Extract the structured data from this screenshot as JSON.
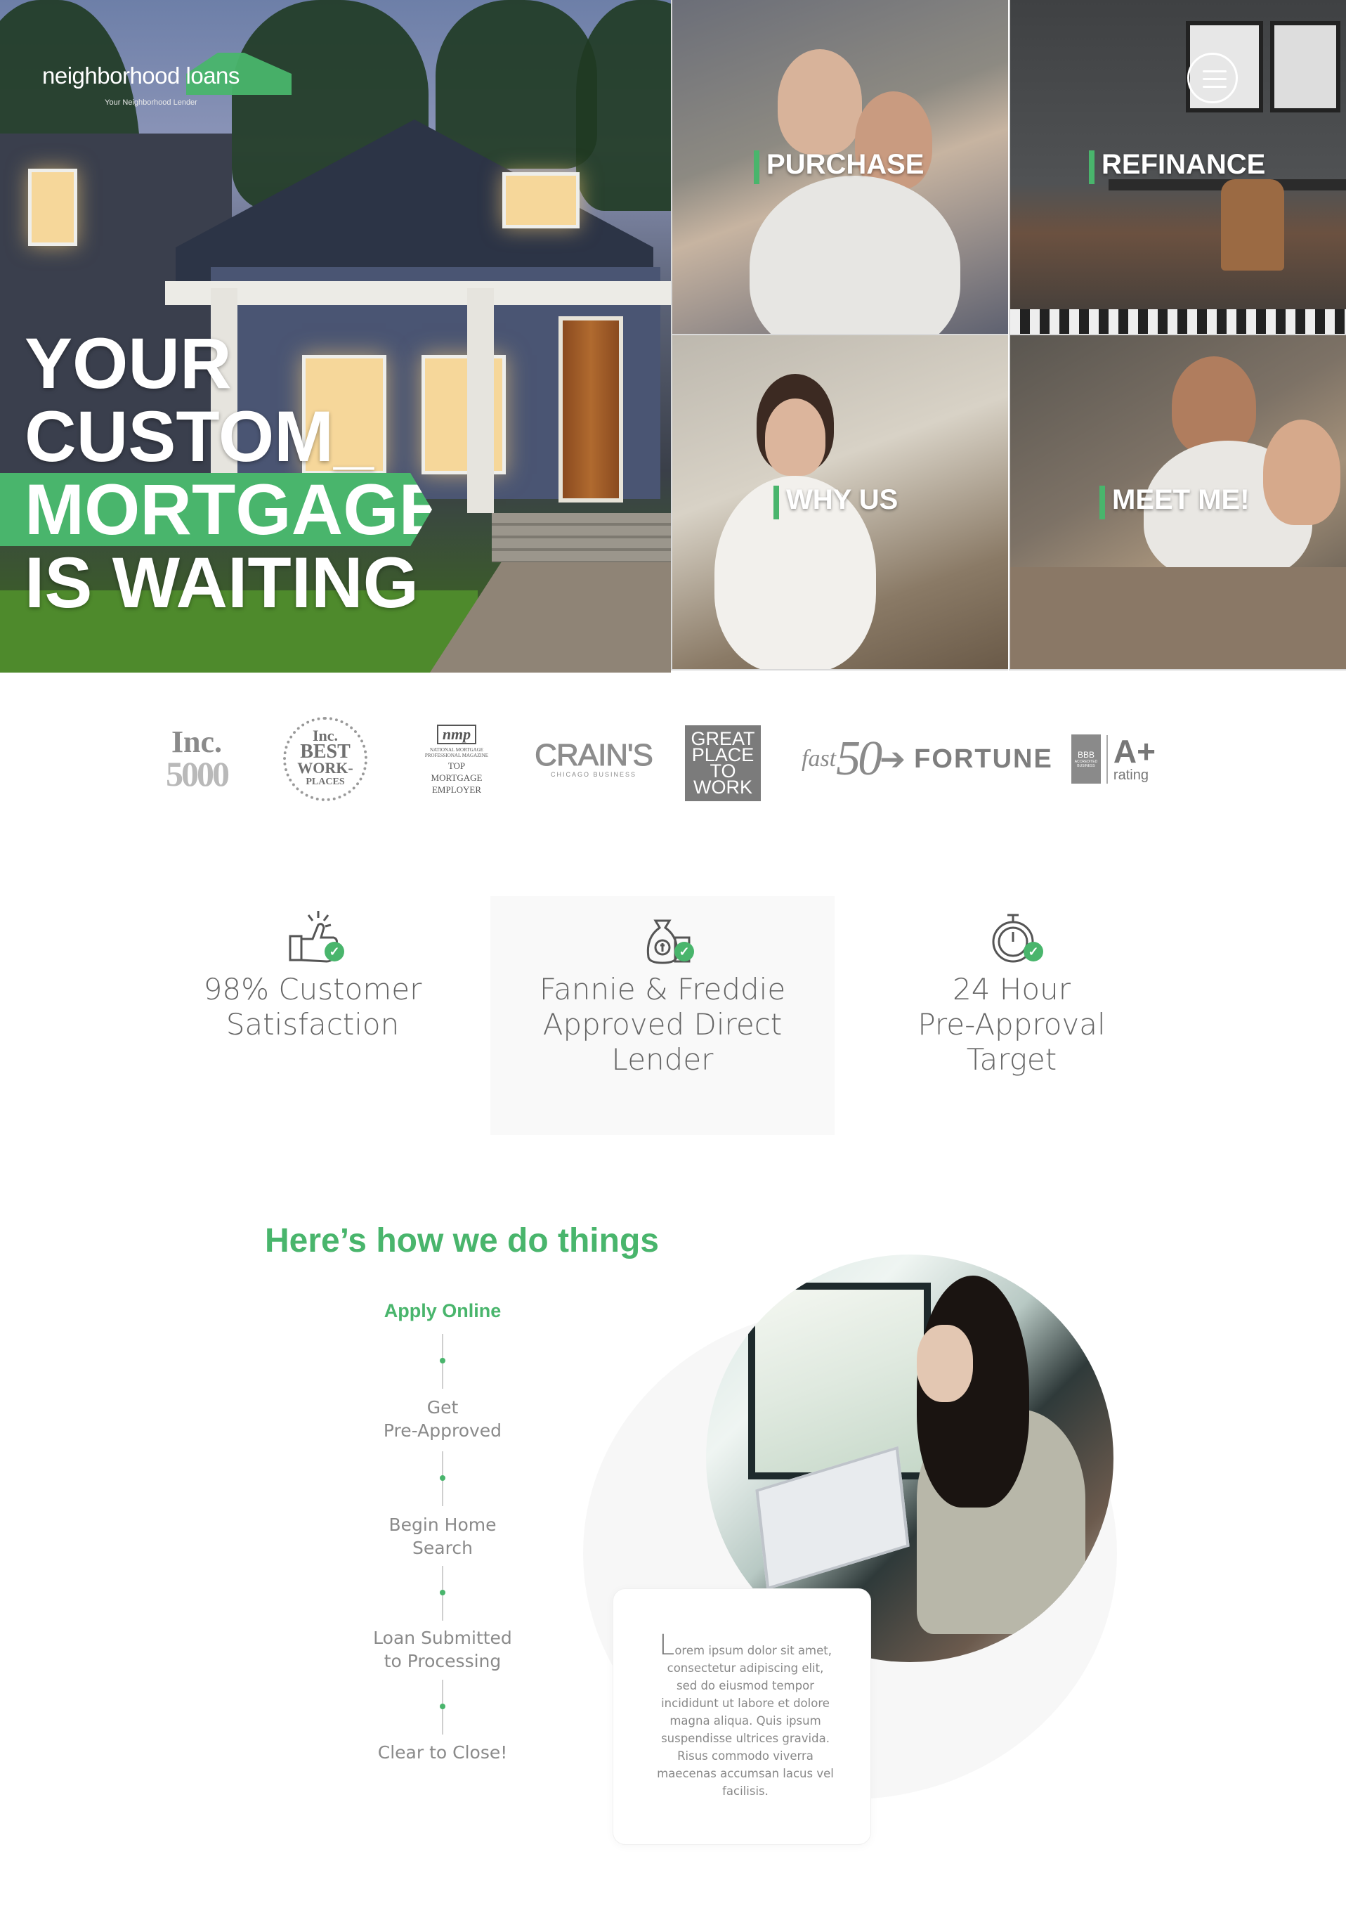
{
  "brand": {
    "logo_text": "neighborhood loans",
    "tagline": "Your Neighborhood Lender",
    "green": "#49b56c"
  },
  "hero": {
    "lines": [
      "YOUR",
      "CUSTOM_",
      "MORTGAGE",
      "IS WAITING"
    ],
    "menu_icon": "hamburger-icon"
  },
  "tiles": [
    {
      "label": "PURCHASE"
    },
    {
      "label": "REFINANCE"
    },
    {
      "label": "WHY US"
    },
    {
      "label": "MEET ME!"
    }
  ],
  "awards": {
    "inc_top": "Inc.",
    "inc_bottom": "5000",
    "best_lines": [
      "Inc.",
      "BEST",
      "WORK-",
      "PLACES"
    ],
    "nmp_logo": "nmp",
    "nmp_small": "NATIONAL MORTGAGE PROFESSIONAL MAGAZINE",
    "nmp_lines": [
      "TOP",
      "MORTGAGE",
      "EMPLOYER"
    ],
    "crains": "CRAIN'S",
    "crains_sub": "CHICAGO BUSINESS",
    "gptw_lines": [
      "GREAT",
      "PLACE",
      "TO",
      "WORK"
    ],
    "fast_a": "fast",
    "fast_b": "50",
    "fortune": "FORTUNE",
    "bbb_seal": "BBB",
    "bbb_sub": "ACCREDITED BUSINESS",
    "bbb_grade": "A+",
    "bbb_rating": "rating"
  },
  "features": [
    {
      "icon": "thumbs-up-icon",
      "lines": [
        "98% Customer",
        "Satisfaction"
      ]
    },
    {
      "icon": "money-bag-icon",
      "lines": [
        "Fannie & Freddie",
        "Approved Direct",
        "Lender"
      ]
    },
    {
      "icon": "stopwatch-icon",
      "lines": [
        "24 Hour",
        "Pre-Approval",
        "Target"
      ]
    }
  ],
  "how": {
    "title": "Here’s how we do things",
    "steps": [
      {
        "lines": [
          "Apply Online"
        ]
      },
      {
        "lines": [
          "Get",
          "Pre-Approved"
        ]
      },
      {
        "lines": [
          "Begin Home",
          "Search"
        ]
      },
      {
        "lines": [
          "Loan Submitted",
          "to Processing"
        ]
      },
      {
        "lines": [
          "Clear to Close!"
        ]
      }
    ],
    "card_initial": "L",
    "card_text": "orem ipsum dolor sit amet, consectetur adipiscing elit, sed do eiusmod tempor incididunt ut labore et dolore magna aliqua. Quis ipsum suspendisse ultrices gravida. Risus commodo viverra maecenas accumsan lacus vel facilisis."
  }
}
